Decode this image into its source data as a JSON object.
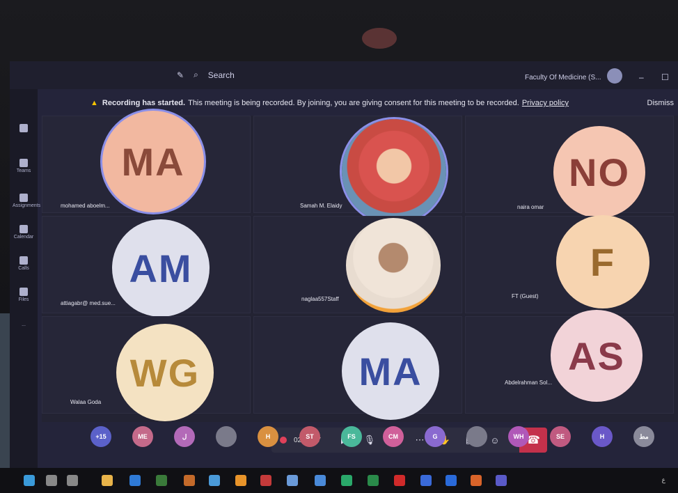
{
  "app": {
    "search_label": "Search",
    "org_label": "Faculty Of Medicine (S...",
    "minimize": "–",
    "maximize": "☐"
  },
  "banner": {
    "bold": "Recording has started.",
    "text": "This meeting is being recorded. By joining, you are giving consent for this meeting to be recorded.",
    "link": "Privacy policy",
    "dismiss": "Dismiss"
  },
  "rail": [
    "Teams",
    "Assignments",
    "Calendar",
    "Calls",
    "Files",
    "..."
  ],
  "tiles": [
    {
      "initials": "MA",
      "name": "mohamed aboelm...",
      "bg": "#f2b8a0",
      "fg": "#8a4a3a"
    },
    {
      "initials": "",
      "name": "Samah M. Elaidy",
      "photo": true
    },
    {
      "initials": "NO",
      "name": "naira omar",
      "bg": "#f5c6b2",
      "fg": "#8b3f38"
    },
    {
      "initials": "AM",
      "name": "attiagabr@ med.sue...",
      "bg": "#dfe0ec",
      "fg": "#3a4ea0"
    },
    {
      "initials": "",
      "name": "naglaa557Staff",
      "photo": true
    },
    {
      "initials": "F",
      "name": "FT (Guest)",
      "bg": "#f7d4b0",
      "fg": "#9a6a2e"
    },
    {
      "initials": "WG",
      "name": "Walaa Goda",
      "bg": "#f4e2c2",
      "fg": "#b78a3a"
    },
    {
      "initials": "MA",
      "name": "",
      "bg": "#dfe0ec",
      "fg": "#3a4ea0"
    },
    {
      "initials": "AS",
      "name": "Abdelrahman Sol...",
      "bg": "#f2d3d8",
      "fg": "#8a3a4a"
    }
  ],
  "controls": {
    "time": "02:23:47"
  },
  "strip": [
    "+15",
    "ME",
    "ل",
    "",
    "H",
    "ST",
    "FS",
    "CM",
    "G",
    "",
    "WH",
    "SE",
    "H",
    "مط"
  ],
  "strip_colors": [
    "#5b61c9",
    "#c46a8a",
    "#b36ab8",
    "#7a7a8a",
    "#d99040",
    "#c25a6a",
    "#4ab89a",
    "#d0609a",
    "#8a6ad0",
    "#7a7a8a",
    "#b058b8",
    "#c05a80",
    "#6a58c8",
    "#8a8a9a"
  ],
  "taskbar_clock": "ع"
}
